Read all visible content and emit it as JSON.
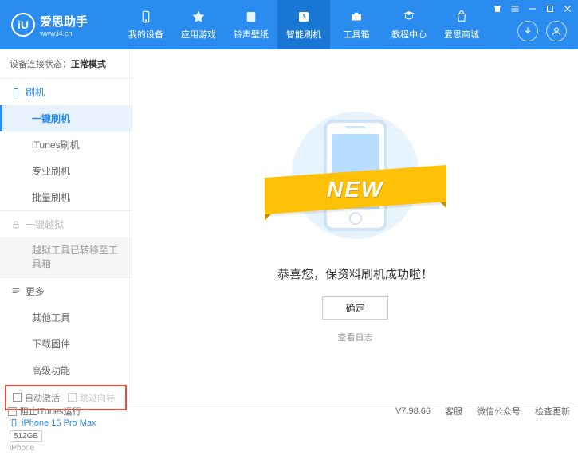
{
  "header": {
    "logo_glyph": "iU",
    "title": "爱思助手",
    "url": "www.i4.cn",
    "nav": [
      {
        "label": "我的设备"
      },
      {
        "label": "应用游戏"
      },
      {
        "label": "铃声壁纸"
      },
      {
        "label": "智能刷机"
      },
      {
        "label": "工具箱"
      },
      {
        "label": "教程中心"
      },
      {
        "label": "爱思商城"
      }
    ]
  },
  "sidebar": {
    "status_label": "设备连接状态：",
    "status_value": "正常模式",
    "section_flash": {
      "title": "刷机",
      "items": [
        "一键刷机",
        "iTunes刷机",
        "专业刷机",
        "批量刷机"
      ]
    },
    "section_jailbreak": {
      "title": "一键越狱",
      "note": "越狱工具已转移至工具箱"
    },
    "section_more": {
      "title": "更多",
      "items": [
        "其他工具",
        "下载固件",
        "高级功能"
      ]
    },
    "checks": {
      "auto_activate": "自动激活",
      "skip_guide": "跳过向导"
    },
    "device": {
      "name": "iPhone 15 Pro Max",
      "storage": "512GB",
      "type": "iPhone"
    }
  },
  "main": {
    "ribbon": "NEW",
    "message": "恭喜您，保资料刷机成功啦！",
    "ok": "确定",
    "view_log": "查看日志"
  },
  "footer": {
    "block_itunes": "阻止iTunes运行",
    "version": "V7.98.66",
    "links": [
      "客服",
      "微信公众号",
      "检查更新"
    ]
  }
}
